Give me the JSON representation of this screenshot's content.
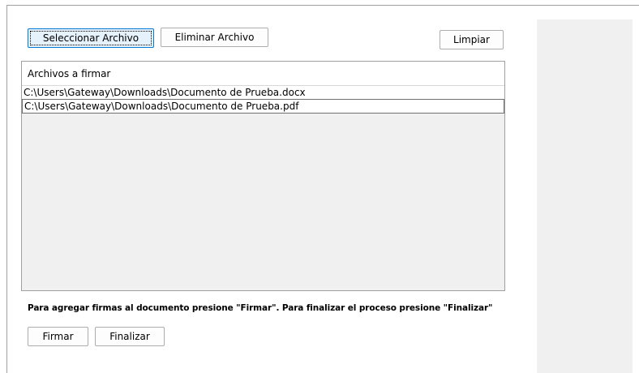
{
  "toolbar": {
    "select_label": "Seleccionar Archivo",
    "delete_label": "Eliminar Archivo",
    "clear_label": "Limpiar"
  },
  "file_list": {
    "header": "Archivos a firmar",
    "items": [
      "C:\\Users\\Gateway\\Downloads\\Documento de Prueba.docx",
      "C:\\Users\\Gateway\\Downloads\\Documento de Prueba.pdf"
    ]
  },
  "instruction": "Para agregar firmas al documento presione \"Firmar\". Para finalizar el proceso presione \"Finalizar\"",
  "actions": {
    "sign_label": "Firmar",
    "finish_label": "Finalizar"
  }
}
